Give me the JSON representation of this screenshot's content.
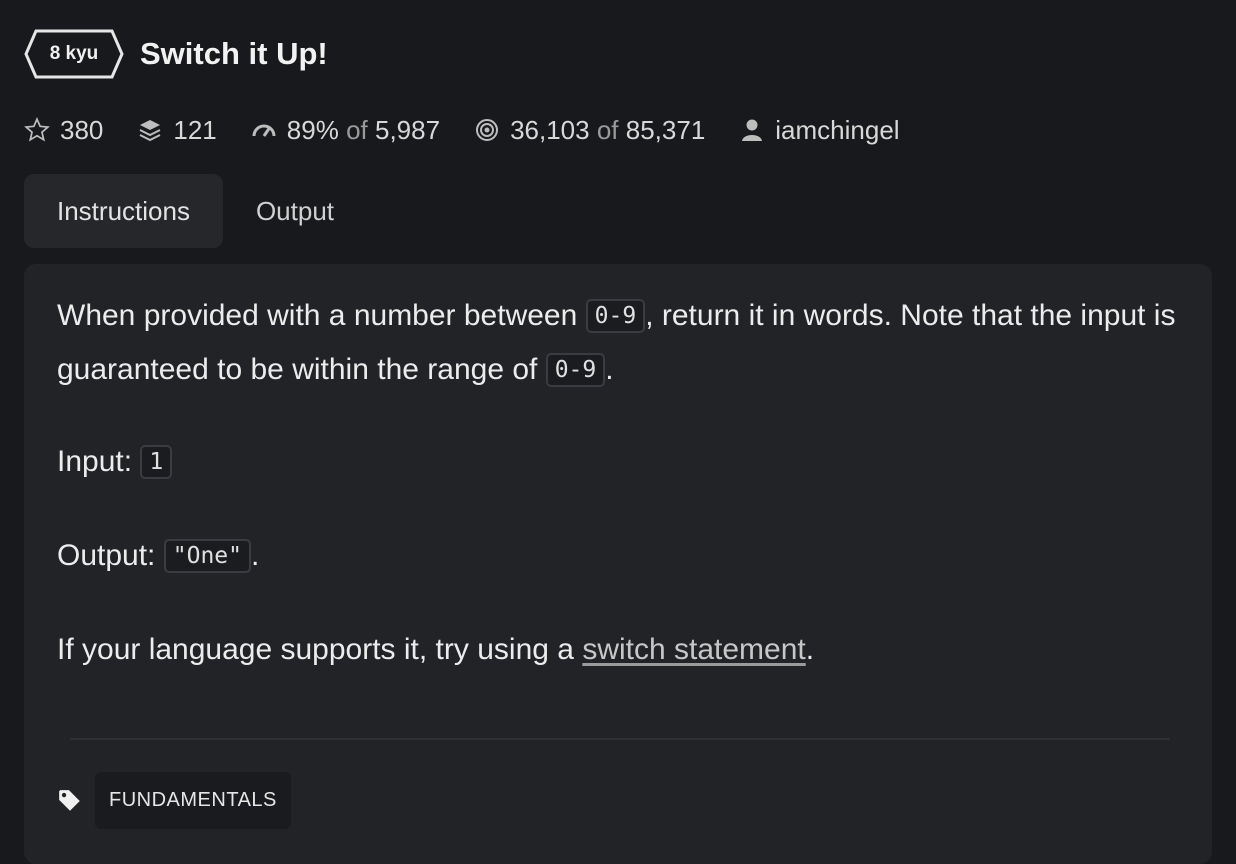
{
  "kata": {
    "rank": "8 kyu",
    "title": "Switch it Up!"
  },
  "stats": {
    "stars": "380",
    "collections": "121",
    "satisfaction": "89%",
    "satisfaction_of": "of",
    "satisfaction_votes": "5,987",
    "completed": "36,103",
    "completed_of": "of",
    "attempts": "85,371",
    "author": "iamchingel"
  },
  "tabs": [
    {
      "label": "Instructions",
      "active": true
    },
    {
      "label": "Output",
      "active": false
    }
  ],
  "description": {
    "p1_a": "When provided with a number between",
    "p1_code1": "0-9",
    "p1_b": ", return it in words. Note that the input is guaranteed to be within the range of",
    "p1_code2": "0-9",
    "p1_c": ".",
    "input_label": "Input:",
    "input_code": "1",
    "output_label": "Output:",
    "output_code": "\"One\"",
    "output_end": ".",
    "p4_a": "If your language supports it, try using a",
    "p4_link": "switch statement",
    "p4_end": "."
  },
  "tags": [
    "FUNDAMENTALS"
  ],
  "icons": {
    "star": "star-outline-icon",
    "collections": "layers-icon",
    "satisfaction": "gauge-icon",
    "completed": "target-icon",
    "author": "user-icon",
    "tag": "tag-icon"
  }
}
